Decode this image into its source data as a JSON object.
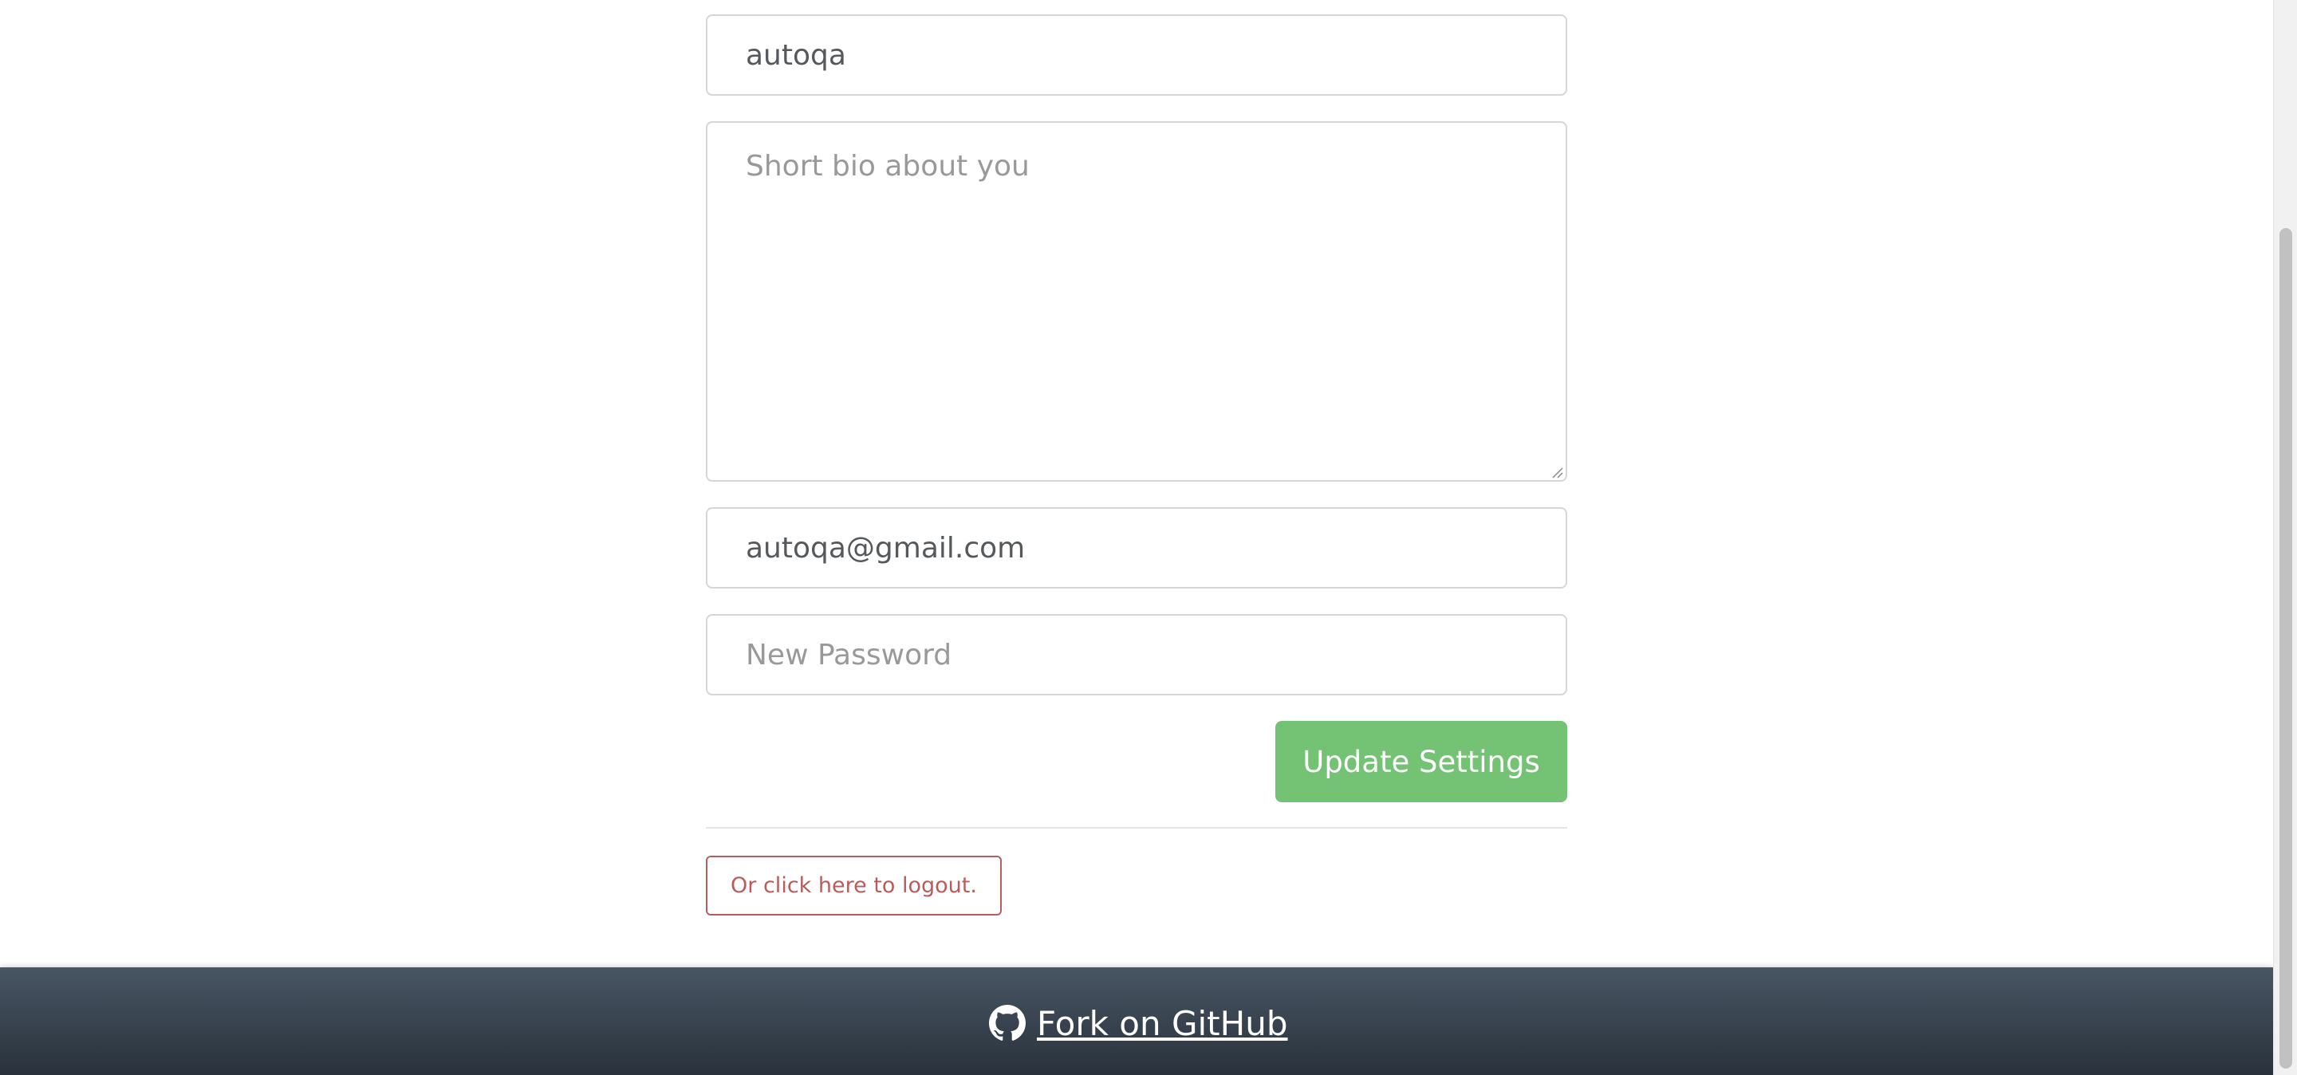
{
  "settings_form": {
    "username_value": "autoqa",
    "bio_placeholder": "Short bio about you",
    "bio_value": "",
    "email_value": "autoqa@gmail.com",
    "password_placeholder": "New Password",
    "password_value": "",
    "update_button_label": "Update Settings"
  },
  "logout": {
    "label": "Or click here to logout."
  },
  "footer": {
    "link_label": "Fork on GitHub",
    "icon": "github-icon"
  },
  "colors": {
    "primary_green": "#5cb85c",
    "logout_red": "#b85c5c",
    "footer_top": "#485563",
    "footer_bottom": "#29323c"
  }
}
